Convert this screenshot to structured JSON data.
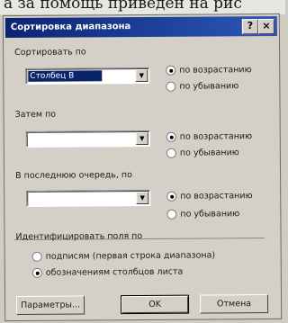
{
  "page_text": "а за помощь приведен на рис",
  "dialog": {
    "title": "Сортировка диапазона",
    "help_glyph": "?",
    "close_glyph": "×",
    "sort_by": {
      "label": "Сортировать по",
      "value": "Столбец B",
      "ascending": "по возрастанию",
      "descending": "по убыванию",
      "selected": "ascending"
    },
    "then_by": {
      "label": "Затем по",
      "value": "",
      "ascending": "по возрастанию",
      "descending": "по убыванию",
      "selected": "ascending"
    },
    "last_by": {
      "label": "В последнюю очередь, по",
      "value": "",
      "ascending": "по возрастанию",
      "descending": "по убыванию",
      "selected": "ascending"
    },
    "identify": {
      "label": "Идентифицировать поля по",
      "option_labels": "подписям (первая строка диапазона)",
      "option_columns": "обозначениям столбцов листа",
      "selected": "columns"
    },
    "buttons": {
      "params": "Параметры...",
      "ok": "OK",
      "cancel": "Отмена"
    },
    "arrow_glyph": "▼"
  }
}
